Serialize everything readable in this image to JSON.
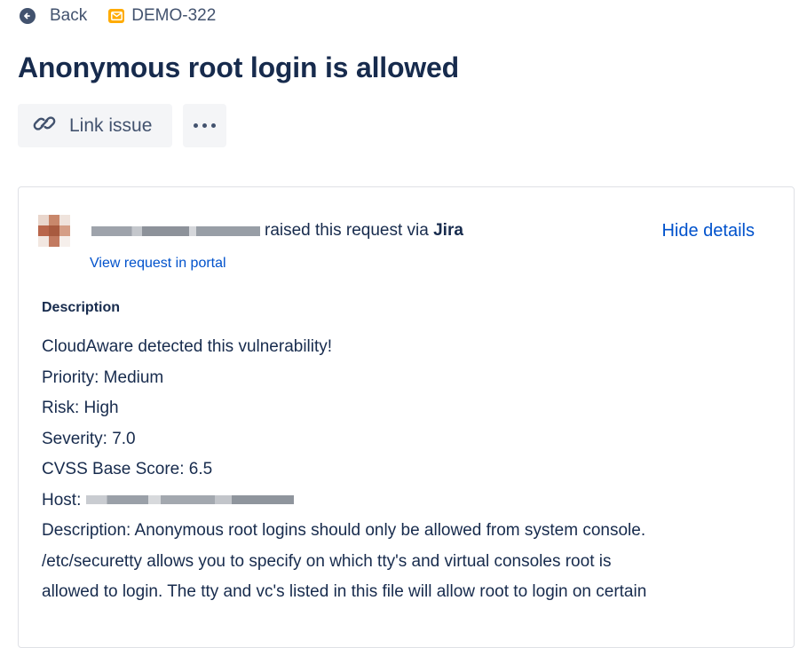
{
  "topbar": {
    "back_label": "Back",
    "issue_key": "DEMO-322",
    "issue_icon": "envelope-icon",
    "issue_icon_color": "#ffab00"
  },
  "issue": {
    "title": "Anonymous root login is allowed"
  },
  "actions": {
    "link_issue_label": "Link issue",
    "link_icon": "link-icon",
    "more_icon": "more-icon"
  },
  "request": {
    "raised_text": "raised this request via",
    "channel": "Jira",
    "view_portal_label": "View request in portal",
    "hide_details_label": "Hide details"
  },
  "description": {
    "heading": "Description",
    "lines": [
      "CloudAware detected this vulnerability!",
      "Priority: Medium",
      "Risk: High",
      "Severity: 7.0",
      "CVSS Base Score: 6.5",
      "Host:",
      "Description: Anonymous root logins should only be allowed from system console.",
      "/etc/securetty allows you to specify on which tty's and virtual consoles root is",
      "allowed to login. The tty and vc's listed in this file will allow root to login on certain"
    ]
  },
  "colors": {
    "text": "#172b4d",
    "link": "#0052cc",
    "button_bg": "#f4f5f7",
    "border": "#dfe1e6"
  }
}
